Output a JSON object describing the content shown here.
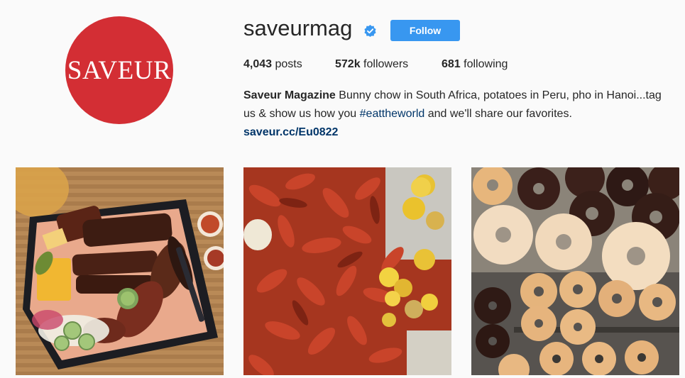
{
  "profile": {
    "avatar_text": "SAVEUR",
    "username": "saveurmag",
    "verified_icon": "verified-badge-icon",
    "follow_label": "Follow",
    "accent_color": "#3897f0",
    "brand_color": "#d32e34"
  },
  "stats": {
    "posts_count": "4,043",
    "posts_label": "posts",
    "followers_count": "572k",
    "followers_label": "followers",
    "following_count": "681",
    "following_label": "following"
  },
  "bio": {
    "name": "Saveur Magazine",
    "text_before": "Bunny chow in South Africa, potatoes in Peru, pho in Hanoi...tag us & show us how you",
    "hashtag": "#eattheworld",
    "text_after": "and we'll share our favorites.",
    "link": "saveur.cc/Eu0822"
  },
  "posts": [
    {
      "subject": "barbecue platter"
    },
    {
      "subject": "crawfish boil"
    },
    {
      "subject": "donuts"
    }
  ]
}
